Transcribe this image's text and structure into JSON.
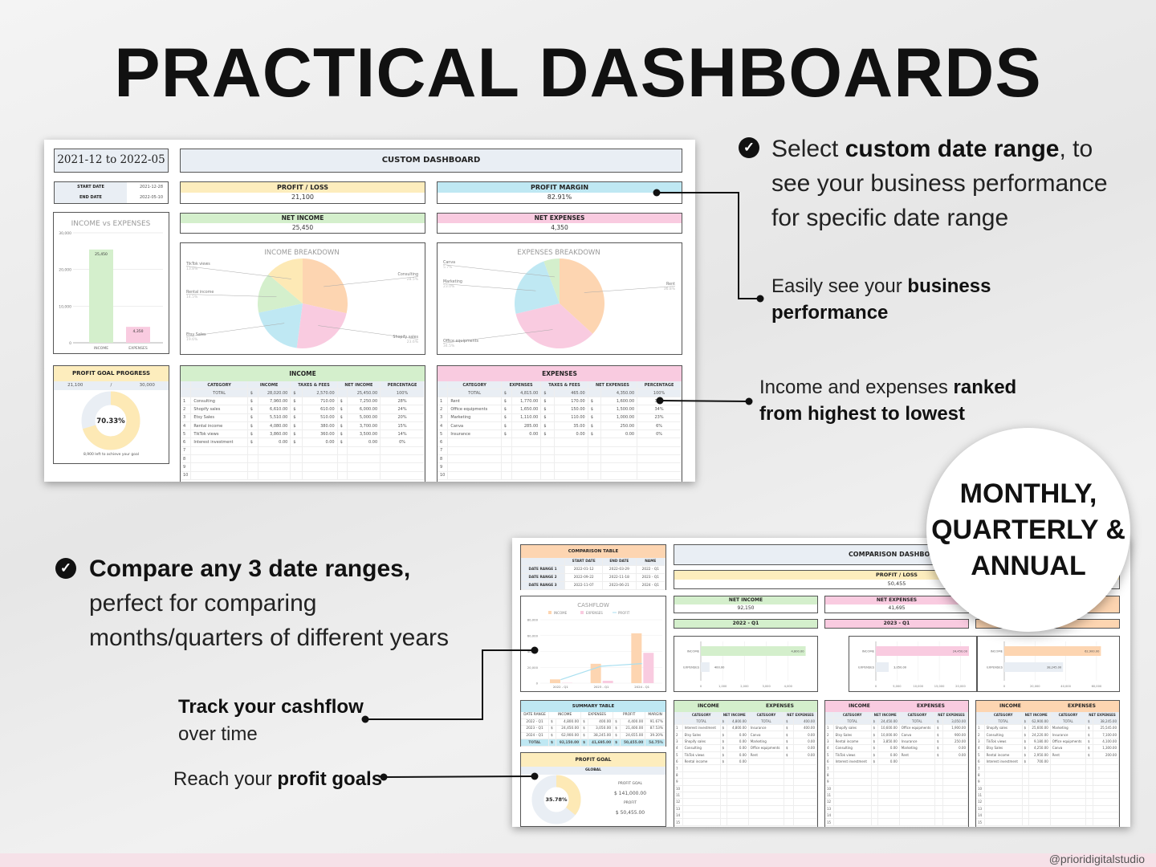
{
  "headline": "PRACTICAL DASHBOARDS",
  "watermark": "@prioridigitalstudio",
  "colors": {
    "peach": "#fdd5b1",
    "pink": "#f9cbe0",
    "blue": "#bfe8f3",
    "green": "#d4efcc",
    "yellow": "#fde9b5",
    "grey": "#e9eef4",
    "profit_line": "#a8dff0"
  },
  "callouts": {
    "custom_range": {
      "icon": "check-circle-icon",
      "pre": "Select ",
      "bold": "custom date range",
      "post": ", to",
      "line2": "see your business performance",
      "line3": "for specific date range"
    },
    "performance": {
      "pre": "Easily see your ",
      "bold1": "business",
      "bold2": "performance"
    },
    "ranked": {
      "pre": "Income and expenses ",
      "bold1": "ranked",
      "bold2": "from highest to lowest"
    },
    "compare": {
      "icon": "check-circle-icon",
      "bold": "Compare any 3 date ranges,",
      "line2": "perfect for comparing",
      "line3": "months/quarters of different years"
    },
    "cashflow": {
      "bold": "Track your cashflow",
      "line2": "over time"
    },
    "goals": {
      "pre": "Reach your ",
      "bold": "profit goals"
    },
    "badge": {
      "line1": "MONTHLY,",
      "line2": "QUARTERLY &",
      "line3": "ANNUAL"
    }
  },
  "custom": {
    "range_title": "2021-12 to 2022-05",
    "header": "CUSTOM DASHBOARD",
    "start_label": "START DATE",
    "start_value": "2021-12-28",
    "end_label": "END DATE",
    "end_value": "2022-05-10",
    "profit_loss": {
      "label": "PROFIT / LOSS",
      "value": "21,100"
    },
    "profit_margin": {
      "label": "PROFIT MARGIN",
      "value": "82.91%"
    },
    "net_income": {
      "label": "NET INCOME",
      "value": "25,450"
    },
    "net_expenses": {
      "label": "NET EXPENSES",
      "value": "4,350"
    },
    "goal": {
      "label": "PROFIT GOAL PROGRESS",
      "current": "21,100",
      "sep": "/",
      "target": "30,000",
      "percent": "70.33%",
      "fraction": 0.7033,
      "left_text": "8,900  left to achieve your goal"
    },
    "currency": "$",
    "income_table": {
      "title": "INCOME",
      "headers": [
        "CATEGORY",
        "INCOME",
        "TAXES & FEES",
        "NET INCOME",
        "PERCENTAGE"
      ],
      "total": {
        "category": "TOTAL",
        "income": "28,020.00",
        "taxes": "2,570.00",
        "net": "25,450.00",
        "pct": "100%"
      },
      "rows": [
        {
          "n": "1",
          "category": "Consulting",
          "income": "7,960.00",
          "taxes": "710.00",
          "net": "7,250.00",
          "pct": "28%"
        },
        {
          "n": "2",
          "category": "Shopify sales",
          "income": "6,610.00",
          "taxes": "610.00",
          "net": "6,000.00",
          "pct": "24%"
        },
        {
          "n": "3",
          "category": "Etsy Sales",
          "income": "5,510.00",
          "taxes": "510.00",
          "net": "5,000.00",
          "pct": "20%"
        },
        {
          "n": "4",
          "category": "Rental income",
          "income": "4,080.00",
          "taxes": "380.00",
          "net": "3,700.00",
          "pct": "15%"
        },
        {
          "n": "5",
          "category": "TikTok views",
          "income": "3,860.00",
          "taxes": "360.00",
          "net": "3,500.00",
          "pct": "14%"
        },
        {
          "n": "6",
          "category": "Interest investment",
          "income": "0.00",
          "taxes": "0.00",
          "net": "0.00",
          "pct": "0%"
        },
        {
          "n": "7"
        },
        {
          "n": "8"
        },
        {
          "n": "9"
        },
        {
          "n": "10"
        }
      ]
    },
    "expenses_table": {
      "title": "EXPENSES",
      "headers": [
        "CATEGORY",
        "EXPENSES",
        "TAXES & FEES",
        "NET EXPENSES",
        "PERCENTAGE"
      ],
      "total": {
        "category": "TOTAL",
        "income": "4,815.00",
        "taxes": "465.00",
        "net": "4,350.00",
        "pct": "100%"
      },
      "rows": [
        {
          "n": "1",
          "category": "Rent",
          "income": "1,770.00",
          "taxes": "170.00",
          "net": "1,600.00",
          "pct": "37%"
        },
        {
          "n": "2",
          "category": "Office equipments",
          "income": "1,650.00",
          "taxes": "150.00",
          "net": "1,500.00",
          "pct": "34%"
        },
        {
          "n": "3",
          "category": "Marketing",
          "income": "1,110.00",
          "taxes": "110.00",
          "net": "1,000.00",
          "pct": "23%"
        },
        {
          "n": "4",
          "category": "Canva",
          "income": "285.00",
          "taxes": "35.00",
          "net": "250.00",
          "pct": "6%"
        },
        {
          "n": "5",
          "category": "Insurance",
          "income": "0.00",
          "taxes": "0.00",
          "net": "0.00",
          "pct": "0%"
        },
        {
          "n": "6"
        },
        {
          "n": "7"
        },
        {
          "n": "8"
        },
        {
          "n": "9"
        },
        {
          "n": "10"
        }
      ]
    }
  },
  "comparison": {
    "header": "COMPARISON DASHBOARD",
    "profit_loss": {
      "label": "PROFIT / LOSS",
      "value": "50,455"
    },
    "net_income": {
      "label": "NET INCOME",
      "value": "92,150"
    },
    "net_expenses": {
      "label": "NET EXPENSES",
      "value": "41,695"
    },
    "table": {
      "title": "COMPARISON TABLE",
      "headers": [
        "START DATE",
        "END DATE",
        "NAME"
      ],
      "rows": [
        {
          "label": "DATE RANGE 1",
          "start": "2022-01-12",
          "end": "2022-03-29",
          "name": "2022 - Q1"
        },
        {
          "label": "DATE RANGE 2",
          "start": "2022-09-22",
          "end": "2022-11-18",
          "name": "2023 - Q1"
        },
        {
          "label": "DATE RANGE 3",
          "start": "2022-11-07",
          "end": "2023-06-21",
          "name": "2024 - Q1"
        }
      ]
    },
    "summary": {
      "title": "SUMMARY TABLE",
      "headers": [
        "DATE RANGE",
        "INCOME",
        "EXPENSES",
        "PROFIT",
        "MARGIN"
      ],
      "rows": [
        {
          "range": "2022 - Q1",
          "income": "4,800.00",
          "expenses": "400.00",
          "profit": "4,400.00",
          "margin": "91.67%"
        },
        {
          "range": "2023 - Q1",
          "income": "24,450.00",
          "expenses": "3,050.00",
          "profit": "21,400.00",
          "margin": "87.53%"
        },
        {
          "range": "2024 - Q1",
          "income": "62,900.00",
          "expenses": "38,245.00",
          "profit": "24,655.00",
          "margin": "39.20%"
        }
      ],
      "total": {
        "range": "TOTAL",
        "income": "92,150.00",
        "expenses": "41,695.00",
        "profit": "50,455.00",
        "margin": "54.75%"
      }
    },
    "goal": {
      "title": "PROFIT GOAL",
      "subtitle": "GLOBAL",
      "percent": "35.78%",
      "fraction": 0.3578,
      "goal_label": "PROFIT GOAL",
      "goal_value": "$ 141,000.00",
      "profit_label": "PROFIT",
      "profit_value": "$ 50,455.00"
    },
    "periods": [
      {
        "name": "2022 - Q1",
        "table": {
          "h_income": "INCOME",
          "h_expenses": "EXPENSES",
          "headers": [
            "CATEGORY",
            "NET INCOME",
            "CATEGORY",
            "NET EXPENSES"
          ],
          "total": {
            "ic": "TOTAL",
            "iv": "4,800.00",
            "ec": "TOTAL",
            "ev": "400.00"
          },
          "rows": [
            {
              "n": "1",
              "ic": "Interest investment",
              "iv": "4,800.00",
              "ec": "Insurance",
              "ev": "400.00"
            },
            {
              "n": "2",
              "ic": "Etsy Sales",
              "iv": "0.00",
              "ec": "Canva",
              "ev": "0.00"
            },
            {
              "n": "3",
              "ic": "Shopify sales",
              "iv": "0.00",
              "ec": "Marketing",
              "ev": "0.00"
            },
            {
              "n": "4",
              "ic": "Consulting",
              "iv": "0.00",
              "ec": "Office equipments",
              "ev": "0.00"
            },
            {
              "n": "5",
              "ic": "TikTok views",
              "iv": "0.00",
              "ec": "Rent",
              "ev": "0.00"
            },
            {
              "n": "6",
              "ic": "Rental income",
              "iv": "0.00"
            },
            {
              "n": "7"
            },
            {
              "n": "8"
            },
            {
              "n": "9"
            },
            {
              "n": "10"
            },
            {
              "n": "11"
            },
            {
              "n": "12"
            },
            {
              "n": "13"
            },
            {
              "n": "14"
            },
            {
              "n": "15"
            }
          ]
        }
      },
      {
        "name": "2023 - Q1",
        "table": {
          "h_income": "INCOME",
          "h_expenses": "EXPENSES",
          "headers": [
            "CATEGORY",
            "NET INCOME",
            "CATEGORY",
            "NET EXPENSES"
          ],
          "total": {
            "ic": "TOTAL",
            "iv": "24,450.00",
            "ec": "TOTAL",
            "ev": "3,050.00"
          },
          "rows": [
            {
              "n": "1",
              "ic": "Shopify sales",
              "iv": "10,600.00",
              "ec": "Office equipments",
              "ev": "1,900.00"
            },
            {
              "n": "2",
              "ic": "Etsy Sales",
              "iv": "10,000.00",
              "ec": "Canva",
              "ev": "900.00"
            },
            {
              "n": "3",
              "ic": "Rental income",
              "iv": "3,850.00",
              "ec": "Insurance",
              "ev": "250.00"
            },
            {
              "n": "4",
              "ic": "Consulting",
              "iv": "0.00",
              "ec": "Marketing",
              "ev": "0.00"
            },
            {
              "n": "5",
              "ic": "TikTok views",
              "iv": "0.00",
              "ec": "Rent",
              "ev": "0.00"
            },
            {
              "n": "6",
              "ic": "Interest investment",
              "iv": "0.00"
            },
            {
              "n": "7"
            },
            {
              "n": "8"
            },
            {
              "n": "9"
            },
            {
              "n": "10"
            },
            {
              "n": "11"
            },
            {
              "n": "12"
            },
            {
              "n": "13"
            },
            {
              "n": "14"
            },
            {
              "n": "15"
            }
          ]
        }
      },
      {
        "name": "2024 - Q1",
        "table": {
          "h_income": "INCOME",
          "h_expenses": "EXPENSES",
          "headers": [
            "CATEGORY",
            "NET INCOME",
            "CATEGORY",
            "NET EXPENSES"
          ],
          "total": {
            "ic": "TOTAL",
            "iv": "62,900.00",
            "ec": "TOTAL",
            "ev": "38,245.00"
          },
          "rows": [
            {
              "n": "1",
              "ic": "Shopify sales",
              "iv": "25,600.00",
              "ec": "Marketing",
              "ev": "25,545.00"
            },
            {
              "n": "2",
              "ic": "Consulting",
              "iv": "24,220.00",
              "ec": "Insurance",
              "ev": "7,100.00"
            },
            {
              "n": "3",
              "ic": "TikTok views",
              "iv": "9,180.00",
              "ec": "Office equipments",
              "ev": "4,100.00"
            },
            {
              "n": "4",
              "ic": "Etsy Sales",
              "iv": "4,250.00",
              "ec": "Canva",
              "ev": "1,300.00"
            },
            {
              "n": "5",
              "ic": "Rental income",
              "iv": "2,950.00",
              "ec": "Rent",
              "ev": "200.00"
            },
            {
              "n": "6",
              "ic": "Interest investment",
              "iv": "700.00"
            },
            {
              "n": "7"
            },
            {
              "n": "8"
            },
            {
              "n": "9"
            },
            {
              "n": "10"
            },
            {
              "n": "11"
            },
            {
              "n": "12"
            },
            {
              "n": "13"
            },
            {
              "n": "14"
            },
            {
              "n": "15"
            }
          ]
        }
      }
    ]
  },
  "chart_data": [
    {
      "id": "income-vs-expenses",
      "type": "bar",
      "title": "INCOME vs EXPENSES",
      "categories": [
        "INCOME",
        "EXPENSES"
      ],
      "values": [
        25450,
        4350
      ],
      "data_labels": [
        "25,450",
        "4,350"
      ],
      "ylim": [
        0,
        30000
      ],
      "yticks": [
        "0",
        "10,000",
        "20,000",
        "30,000"
      ],
      "grid": true
    },
    {
      "id": "income-breakdown",
      "type": "pie",
      "title": "INCOME BREAKDOWN",
      "labels": [
        "Consulting",
        "Shopify sales",
        "Etsy Sales",
        "Rental income",
        "TikTok views"
      ],
      "values": [
        28.5,
        23.6,
        19.6,
        14.5,
        13.8
      ],
      "value_labels": [
        "28.5%",
        "23.6%",
        "19.6%",
        "14.5%",
        "13.8%"
      ]
    },
    {
      "id": "expenses-breakdown",
      "type": "pie",
      "title": "EXPENSES BREAKDOWN",
      "labels": [
        "Rent",
        "Office equipments",
        "Marketing",
        "Canva"
      ],
      "values": [
        36.8,
        34.5,
        23.0,
        5.7
      ],
      "value_labels": [
        "36.8%",
        "34.5%",
        "23.0%",
        "5.7%"
      ]
    },
    {
      "id": "cashflow",
      "type": "bar",
      "title": "CASHFLOW",
      "categories": [
        "2022 - Q1",
        "2023 - Q1",
        "2024 - Q1"
      ],
      "series": [
        {
          "name": "INCOME",
          "type": "bar",
          "values": [
            4800,
            24450,
            62900
          ]
        },
        {
          "name": "EXPENSES",
          "type": "bar",
          "values": [
            400,
            3050,
            38245
          ]
        },
        {
          "name": "PROFIT",
          "type": "line",
          "values": [
            4400,
            21400,
            24655
          ]
        }
      ],
      "ylim": [
        0,
        80000
      ],
      "yticks": [
        "0",
        "20,000",
        "40,000",
        "60,000",
        "80,000"
      ],
      "legend": "top",
      "grid": true
    },
    {
      "id": "period-1",
      "type": "bar",
      "orientation": "horizontal",
      "categories": [
        "INCOME",
        "EXPENSES"
      ],
      "values": [
        4800,
        400
      ],
      "data_labels": [
        "4,800.00",
        "400.00"
      ],
      "xlim": [
        0,
        5000
      ],
      "xticks": [
        "0",
        "1,000",
        "2,000",
        "3,000",
        "4,000"
      ]
    },
    {
      "id": "period-2",
      "type": "bar",
      "orientation": "horizontal",
      "categories": [
        "INCOME",
        "EXPENSES"
      ],
      "values": [
        24450,
        3050
      ],
      "data_labels": [
        "24,450.00",
        "3,050.00"
      ],
      "xlim": [
        0,
        22000
      ],
      "xticks": [
        "0",
        "5,000",
        "10,000",
        "15,000",
        "20,000"
      ]
    },
    {
      "id": "period-3",
      "type": "bar",
      "orientation": "horizontal",
      "categories": [
        "INCOME",
        "EXPENSES"
      ],
      "values": [
        62900,
        38245
      ],
      "data_labels": [
        "62,900.00",
        "38,245.00"
      ],
      "xlim": [
        0,
        70000
      ],
      "xticks": [
        "0",
        "20,000",
        "40,000",
        "60,000"
      ]
    }
  ]
}
